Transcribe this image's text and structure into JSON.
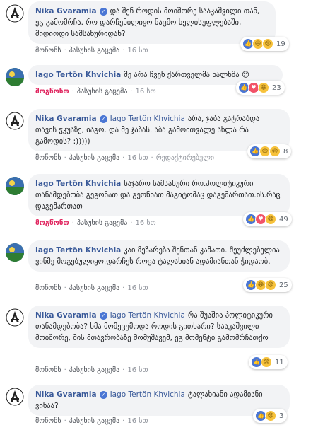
{
  "comments": [
    {
      "author": "Nika Gvaramia",
      "verified": true,
      "mention": "",
      "text": "და შენ როდის მოიშორე სააკაშვილი თან, ეგ გამომრჩა. რო დარჩენილიყო ნაცმო ხელისუფლებაში, მიდიოდი სამსახურიდან?",
      "actions": [
        "მოწონს",
        "პასუხის გაცემა"
      ],
      "time": "16 სთ",
      "liked": false,
      "reactions": [
        "like",
        "haha",
        "sad"
      ],
      "count": "19"
    },
    {
      "author": "Iago Tertön Khvichia",
      "verified": false,
      "mention": "",
      "text": "მე არა ჩვენ ქართველმა ხალხმა 😊",
      "actions": [
        "მოგწონთ",
        "პასუხის გაცემა"
      ],
      "time": "16 სთ",
      "liked": true,
      "reactions": [
        "like",
        "love",
        "haha"
      ],
      "count": "23"
    },
    {
      "author": "Nika Gvaramia",
      "verified": true,
      "mention": "Iago Tertön Khvichia",
      "text": "არა, ჯაბა გატრაბდა თავის ჭკუაზე, იაგო. და მე ჯაბას. აბა გამოითვალე ახლა რა გამოდის? :)))))",
      "actions": [
        "მოწონს",
        "პასუხის გაცემა"
      ],
      "time": "16 სთ",
      "edited": "რედაქტირებული",
      "liked": false,
      "reactions": [
        "like",
        "haha",
        "sad"
      ],
      "count": "8"
    },
    {
      "author": "Iago Tertön Khvichia",
      "verified": false,
      "mention": "",
      "text": "საჯარო სამსახური რო.პოლიტიკური თანამდებობა გეგონათ და გეონიათ მაგიტომაც დაგემართათ.ის.რაც დაგემართათ",
      "actions": [
        "მოგწონთ",
        "პასუხის გაცემა"
      ],
      "time": "16 სთ",
      "liked": true,
      "reactions": [
        "like",
        "love",
        "haha"
      ],
      "count": "49"
    },
    {
      "author": "Iago Tertön Khvichia",
      "verified": false,
      "mention": "",
      "text": "კაი მეზარება შენთან კამათი. შეუძლებელია ვინმე მოგებულიყო.დარჩეს როცა ტალახიან ადამიანთან ჭიდაობ.",
      "actions": [
        "მოწონს",
        "პასუხის გაცემა"
      ],
      "time": "16 სთ",
      "liked": false,
      "reactions": [
        "like",
        "haha",
        "sad"
      ],
      "count": "25"
    },
    {
      "author": "Nika Gvaramia",
      "verified": true,
      "mention": "Iago Tertön Khvichia",
      "text": "რა შუაშია პოლიტიკური თანამდებობა? ხმა მომეცემოდა როდის გითხარი? სააკაშვილი მოიშორე, მის მთავრობაზე მომუშავემ, ეგ მომენტი გამომრჩათქო",
      "actions": [
        "მოწონს",
        "პასუხის გაცემა"
      ],
      "time": "16 სთ",
      "liked": false,
      "reactions": [
        "like",
        "sad"
      ],
      "count": "11"
    },
    {
      "author": "Nika Gvaramia",
      "verified": true,
      "mention": "Iago Tertön Khvichia",
      "text": "ტალახიანი ადამიანი ვინაა?",
      "actions": [
        "მოწონს",
        "პასუხის გაცემა"
      ],
      "time": "16 სთ",
      "liked": false,
      "reactions": [
        "like",
        "sad"
      ],
      "count": "3"
    }
  ],
  "reaction_icons": {
    "like": "👍",
    "love": "♥",
    "haha": "😆",
    "sad": "😢"
  },
  "colors": {
    "link": "#385898",
    "liked": "#e0245e",
    "bubble": "#f2f3f5"
  }
}
